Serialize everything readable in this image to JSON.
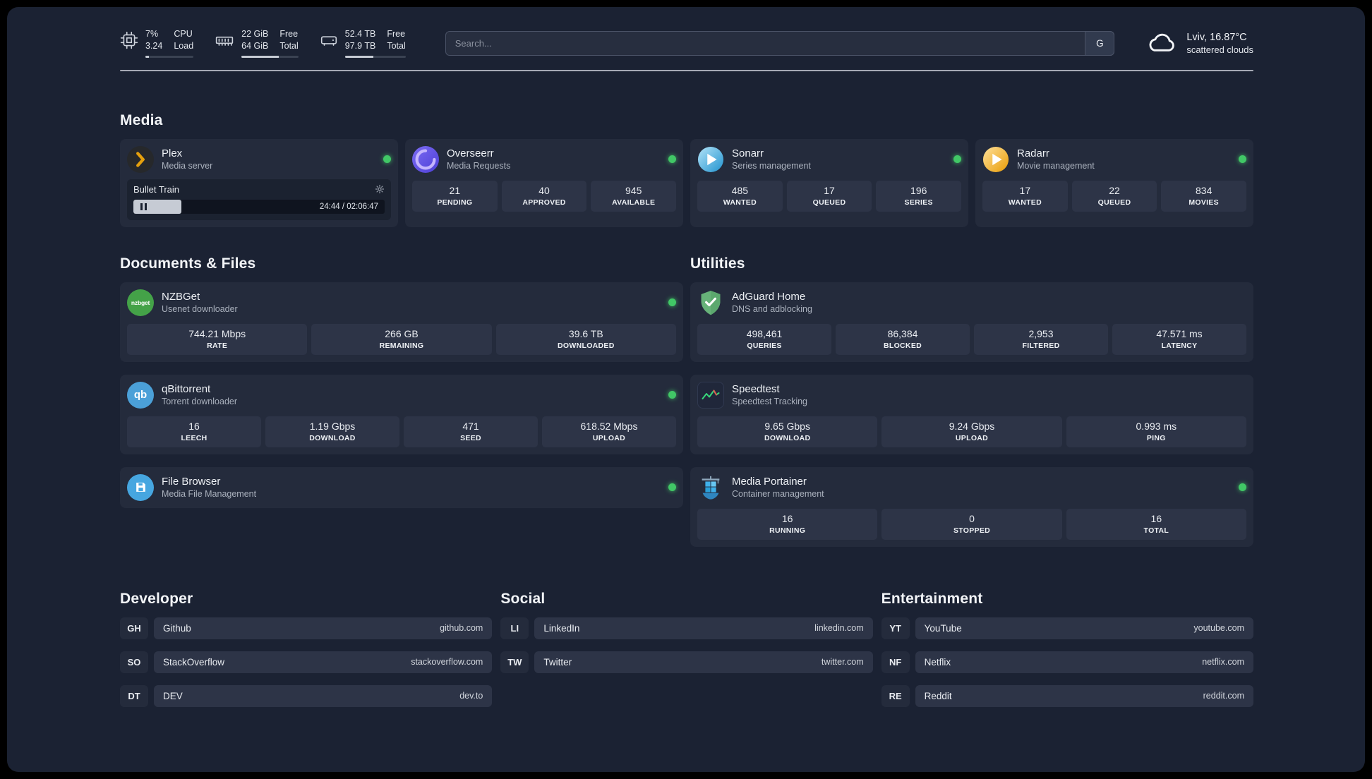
{
  "topbar": {
    "cpu": {
      "value1": "7%",
      "value2": "3.24",
      "label1": "CPU",
      "label2": "Load",
      "percent": 7
    },
    "ram": {
      "value1": "22 GiB",
      "value2": "64 GiB",
      "label1": "Free",
      "label2": "Total",
      "percent": 66
    },
    "disk": {
      "value1": "52.4 TB",
      "value2": "97.9 TB",
      "label1": "Free",
      "label2": "Total",
      "percent": 47
    },
    "search": {
      "placeholder": "Search...",
      "button": "G"
    },
    "weather": {
      "location": "Lviv, 16.87°C",
      "condition": "scattered clouds"
    }
  },
  "sections": {
    "media": "Media",
    "documents": "Documents & Files",
    "utilities": "Utilities",
    "developer": "Developer",
    "social": "Social",
    "entertainment": "Entertainment"
  },
  "apps": {
    "plex": {
      "name": "Plex",
      "subtitle": "Media server",
      "now_playing": "Bullet Train",
      "time": "24:44 / 02:06:47",
      "progress": 19
    },
    "overseerr": {
      "name": "Overseerr",
      "subtitle": "Media Requests",
      "stats": [
        {
          "value": "21",
          "label": "PENDING"
        },
        {
          "value": "40",
          "label": "APPROVED"
        },
        {
          "value": "945",
          "label": "AVAILABLE"
        }
      ]
    },
    "sonarr": {
      "name": "Sonarr",
      "subtitle": "Series management",
      "stats": [
        {
          "value": "485",
          "label": "WANTED"
        },
        {
          "value": "17",
          "label": "QUEUED"
        },
        {
          "value": "196",
          "label": "SERIES"
        }
      ]
    },
    "radarr": {
      "name": "Radarr",
      "subtitle": "Movie management",
      "stats": [
        {
          "value": "17",
          "label": "WANTED"
        },
        {
          "value": "22",
          "label": "QUEUED"
        },
        {
          "value": "834",
          "label": "MOVIES"
        }
      ]
    },
    "nzbget": {
      "name": "NZBGet",
      "subtitle": "Usenet downloader",
      "icon_text": "nzbget",
      "stats": [
        {
          "value": "744.21 Mbps",
          "label": "RATE"
        },
        {
          "value": "266 GB",
          "label": "REMAINING"
        },
        {
          "value": "39.6 TB",
          "label": "DOWNLOADED"
        }
      ]
    },
    "qbittorrent": {
      "name": "qBittorrent",
      "subtitle": "Torrent downloader",
      "icon_text": "qb",
      "stats": [
        {
          "value": "16",
          "label": "LEECH"
        },
        {
          "value": "1.19 Gbps",
          "label": "DOWNLOAD"
        },
        {
          "value": "471",
          "label": "SEED"
        },
        {
          "value": "618.52 Mbps",
          "label": "UPLOAD"
        }
      ]
    },
    "filebrowser": {
      "name": "File Browser",
      "subtitle": "Media File Management"
    },
    "adguard": {
      "name": "AdGuard Home",
      "subtitle": "DNS and adblocking",
      "stats": [
        {
          "value": "498,461",
          "label": "QUERIES"
        },
        {
          "value": "86,384",
          "label": "BLOCKED"
        },
        {
          "value": "2,953",
          "label": "FILTERED"
        },
        {
          "value": "47.571 ms",
          "label": "LATENCY"
        }
      ]
    },
    "speedtest": {
      "name": "Speedtest",
      "subtitle": "Speedtest Tracking",
      "stats": [
        {
          "value": "9.65 Gbps",
          "label": "DOWNLOAD"
        },
        {
          "value": "9.24 Gbps",
          "label": "UPLOAD"
        },
        {
          "value": "0.993 ms",
          "label": "PING"
        }
      ]
    },
    "portainer": {
      "name": "Media Portainer",
      "subtitle": "Container management",
      "stats": [
        {
          "value": "16",
          "label": "RUNNING"
        },
        {
          "value": "0",
          "label": "STOPPED"
        },
        {
          "value": "16",
          "label": "TOTAL"
        }
      ]
    }
  },
  "bookmarks": {
    "developer": [
      {
        "abbr": "GH",
        "name": "Github",
        "url": "github.com"
      },
      {
        "abbr": "SO",
        "name": "StackOverflow",
        "url": "stackoverflow.com"
      },
      {
        "abbr": "DT",
        "name": "DEV",
        "url": "dev.to"
      }
    ],
    "social": [
      {
        "abbr": "LI",
        "name": "LinkedIn",
        "url": "linkedin.com"
      },
      {
        "abbr": "TW",
        "name": "Twitter",
        "url": "twitter.com"
      }
    ],
    "entertainment": [
      {
        "abbr": "YT",
        "name": "YouTube",
        "url": "youtube.com"
      },
      {
        "abbr": "NF",
        "name": "Netflix",
        "url": "netflix.com"
      },
      {
        "abbr": "RE",
        "name": "Reddit",
        "url": "reddit.com"
      }
    ]
  },
  "colors": {
    "page_bg": "#1b2233",
    "card_bg": "#242b3c",
    "stat_bg": "#2d3447",
    "status_online": "#41c766",
    "plex_accent": "#e5a00d",
    "adguard_green": "#67b279",
    "speedtest_green": "#37d67a"
  }
}
